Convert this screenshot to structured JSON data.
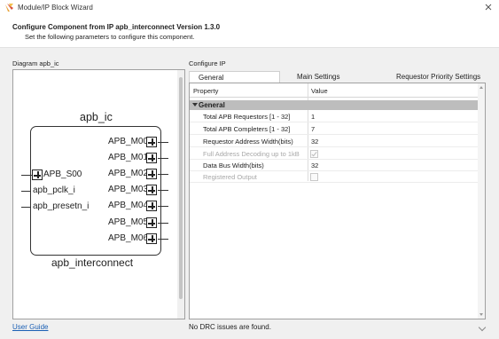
{
  "window": {
    "title": "Module/IP Block Wizard",
    "app_icon": "vivado-logo-icon",
    "close_icon": "close-icon"
  },
  "header": {
    "title": "Configure Component from IP apb_interconnect Version 1.3.0",
    "subtitle": "Set the following parameters to configure this component."
  },
  "diagram": {
    "caption": "Diagram apb_ic",
    "block_name": "apb_ic",
    "module_name": "apb_interconnect",
    "left_ports": [
      "APB_S00",
      "apb_pclk_i",
      "apb_presetn_i"
    ],
    "right_ports": [
      "APB_M00",
      "APB_M01",
      "APB_M02",
      "APB_M03",
      "APB_M04",
      "APB_M05",
      "APB_M06"
    ]
  },
  "configure": {
    "caption": "Configure IP",
    "tabs": [
      "General",
      "Main Settings",
      "Requestor Priority Settings"
    ],
    "active_tab": "General",
    "columns": {
      "property": "Property",
      "value": "Value"
    },
    "group": "General",
    "rows": [
      {
        "name": "Total APB Requestors  [1 - 32]",
        "value": "1"
      },
      {
        "name": "Total APB Completers  [1 - 32]",
        "value": "7"
      },
      {
        "name": "Requestor Address Width(bits)",
        "value": "32"
      },
      {
        "name": "Full Address Decoding up to 1kB",
        "value": ""
      },
      {
        "name": "Data Bus Width(bits)",
        "value": "32"
      },
      {
        "name": "Registered Output",
        "value": ""
      }
    ]
  },
  "footer": {
    "user_guide": "User Guide",
    "status": "No DRC issues are found."
  }
}
